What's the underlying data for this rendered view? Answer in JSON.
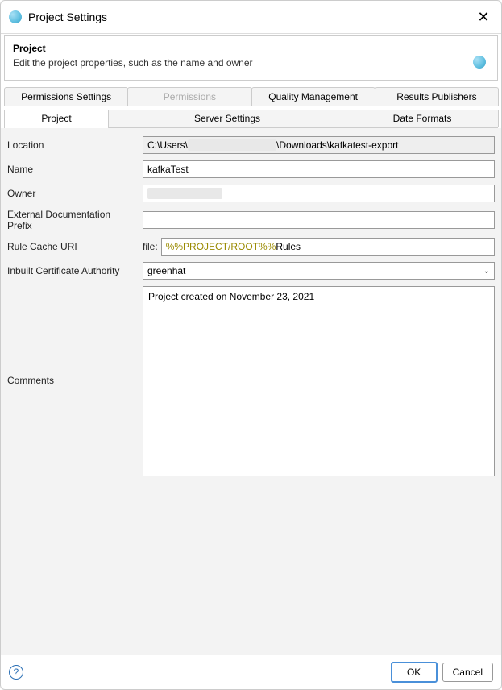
{
  "title": "Project Settings",
  "header": {
    "title": "Project",
    "description": "Edit the project properties, such as the name and owner"
  },
  "tabs": {
    "row1": [
      {
        "label": "Permissions Settings",
        "enabled": true
      },
      {
        "label": "Permissions",
        "enabled": false
      },
      {
        "label": "Quality Management",
        "enabled": true
      },
      {
        "label": "Results Publishers",
        "enabled": true
      }
    ],
    "row2": [
      {
        "label": "Project",
        "active": true
      },
      {
        "label": "Server Settings",
        "active": false
      },
      {
        "label": "Date Formats",
        "active": false
      }
    ]
  },
  "form": {
    "location_label": "Location",
    "location_prefix": "C:\\Users\\",
    "location_obscured": "████████████",
    "location_suffix": "\\Downloads\\kafkatest-export",
    "name_label": "Name",
    "name_value": "kafkaTest",
    "owner_label": "Owner",
    "owner_obscured": "██████████",
    "ext_doc_label": "External Documentation Prefix",
    "ext_doc_value": "",
    "rule_cache_label": "Rule Cache URI",
    "rule_cache_prefix": "file:",
    "rule_cache_var": "%%PROJECT/ROOT%%",
    "rule_cache_suffix": "Rules",
    "cert_label": "Inbuilt Certificate Authority",
    "cert_value": "greenhat",
    "comments_label": "Comments",
    "comments_value": "Project created on November 23, 2021"
  },
  "footer": {
    "ok": "OK",
    "cancel": "Cancel",
    "help": "?"
  }
}
